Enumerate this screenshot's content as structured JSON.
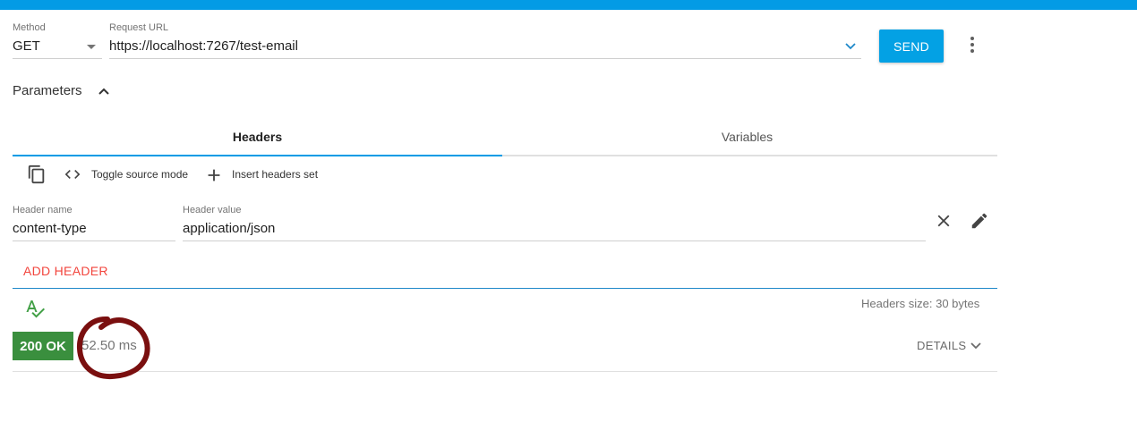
{
  "request": {
    "method_label": "Method",
    "method_value": "GET",
    "url_label": "Request URL",
    "url_value": "https://localhost:7267/test-email",
    "send_label": "SEND"
  },
  "parameters": {
    "title": "Parameters",
    "tabs": [
      {
        "label": "Headers",
        "active": true
      },
      {
        "label": "Variables",
        "active": false
      }
    ],
    "toolbar": {
      "toggle_source": "Toggle source mode",
      "insert_set": "Insert headers set"
    },
    "header_row": {
      "name_label": "Header name",
      "name_value": "content-type",
      "value_label": "Header value",
      "value_value": "application/json"
    },
    "add_header": "ADD HEADER",
    "headers_size": "Headers size: 30 bytes"
  },
  "response": {
    "status": "200 OK",
    "time": "52.50 ms",
    "details": "DETAILS"
  },
  "colors": {
    "accent": "#039be5",
    "status_ok": "#3a8f3e",
    "add_header": "#f2453d",
    "annotation": "#7a0f0f"
  },
  "icons": [
    "kebab-menu-icon",
    "chevron-up-icon",
    "chevron-down-icon",
    "copy-icon",
    "code-icon",
    "plus-icon",
    "close-icon",
    "edit-pencil-icon",
    "spellcheck-icon"
  ]
}
